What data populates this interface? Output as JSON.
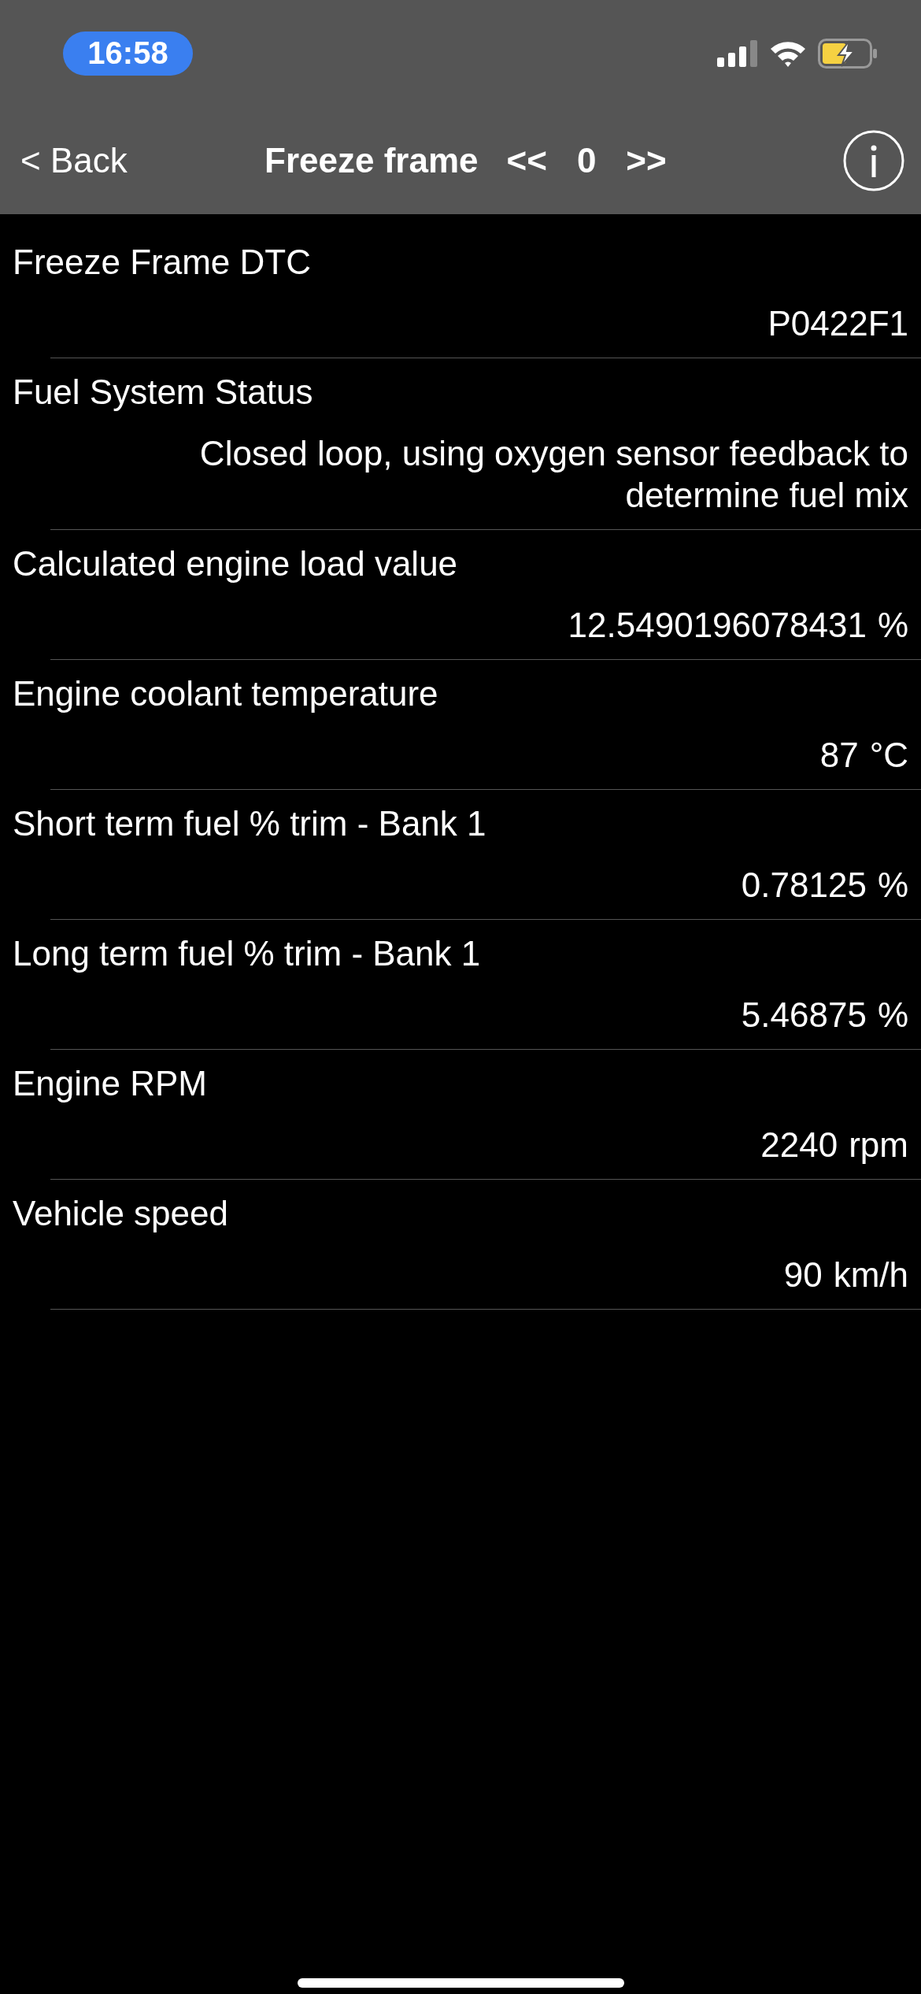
{
  "status_bar": {
    "time": "16:58"
  },
  "nav": {
    "back": "< Back",
    "title": "Freeze frame",
    "prev": "<<",
    "frame": "0",
    "next": ">>"
  },
  "rows": [
    {
      "label": "Freeze Frame DTC",
      "value": "P0422F1"
    },
    {
      "label": "Fuel System Status",
      "value": "Closed loop, using oxygen sensor feedback to determine fuel mix"
    },
    {
      "label": "Calculated engine load value",
      "value": "12.5490196078431",
      "unit": "%"
    },
    {
      "label": "Engine coolant temperature",
      "value": "87",
      "unit": "°C"
    },
    {
      "label": "Short term fuel % trim - Bank 1",
      "value": "0.78125",
      "unit": "%"
    },
    {
      "label": "Long term fuel % trim - Bank 1",
      "value": "5.46875",
      "unit": "%"
    },
    {
      "label": "Engine RPM",
      "value": "2240",
      "unit": "rpm"
    },
    {
      "label": "Vehicle speed",
      "value": "90",
      "unit": "km/h"
    }
  ]
}
